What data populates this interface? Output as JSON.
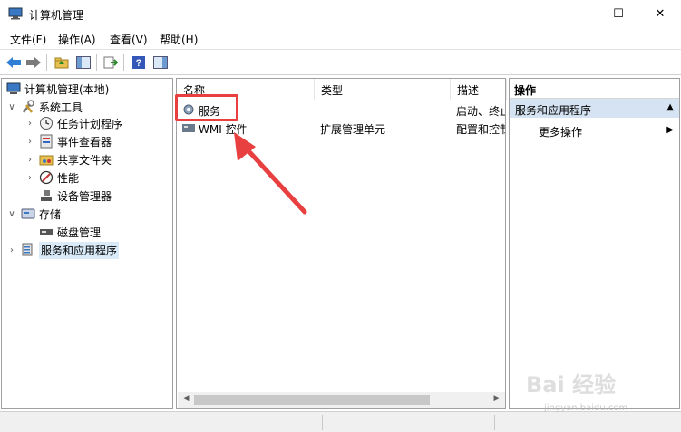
{
  "window": {
    "title": "计算机管理",
    "minimize": "—",
    "maximize": "☐",
    "close": "✕"
  },
  "menu": {
    "items": [
      "文件(F)",
      "操作(A)",
      "查看(V)",
      "帮助(H)"
    ]
  },
  "tree": {
    "root": "计算机管理(本地)",
    "system_tools": "系统工具",
    "task_scheduler": "任务计划程序",
    "event_viewer": "事件查看器",
    "shared_folders": "共享文件夹",
    "performance": "性能",
    "device_manager": "设备管理器",
    "storage": "存储",
    "disk_management": "磁盘管理",
    "services_apps": "服务和应用程序"
  },
  "list": {
    "columns": [
      "名称",
      "类型",
      "描述"
    ],
    "rows": [
      {
        "name": "服务",
        "type": "",
        "desc": "启动、终止"
      },
      {
        "name": "WMI 控件",
        "type": "扩展管理单元",
        "desc": "配置和控制"
      }
    ]
  },
  "actions": {
    "header": "操作",
    "section": "服务和应用程序",
    "more": "更多操作"
  },
  "watermark": {
    "main": "Bai 经验",
    "sub": "jingyan.baidu.com"
  },
  "colors": {
    "annotation": "#e84040",
    "selection": "#d9ebf9",
    "section_bg": "#d5e3f2"
  }
}
